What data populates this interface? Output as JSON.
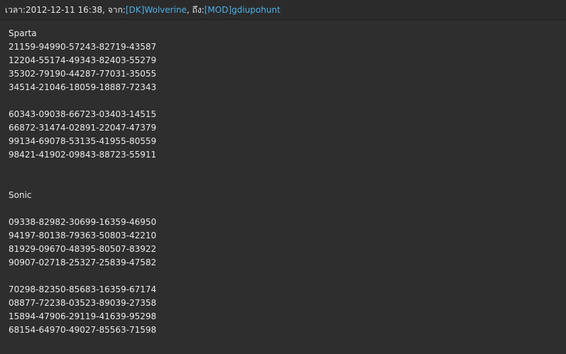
{
  "header": {
    "time_label": "เวลา:",
    "time_value": "2012-12-11 16:38",
    "from_label": "จาก:",
    "from_user": "[DK]Wolverine",
    "to_label": "ถึง:",
    "to_user": "[MOD]gdiupohunt"
  },
  "sections": [
    {
      "title": "Sparta",
      "group1": [
        "21159-94990-57243-82719-43587",
        "12204-55174-49343-82403-55279",
        "35302-79190-44287-77031-35055",
        "34514-21046-18059-18887-72343"
      ],
      "group2": [
        "60343-09038-66723-03403-14515",
        "66872-31474-02891-22047-47379",
        "99134-69078-53135-41955-80559",
        "98421-41902-09843-88723-55911"
      ]
    },
    {
      "title": "Sonic",
      "group1": [
        "09338-82982-30699-16359-46950",
        "94197-80138-79363-50803-42210",
        "81929-09670-48395-80507-83922",
        "90907-02718-25327-25839-47582"
      ],
      "group2": [
        "70298-82350-85683-16359-67174",
        "08877-72238-03523-89039-27358",
        "15894-47906-29119-41639-95298",
        "68154-64970-49027-85563-71598"
      ]
    }
  ]
}
